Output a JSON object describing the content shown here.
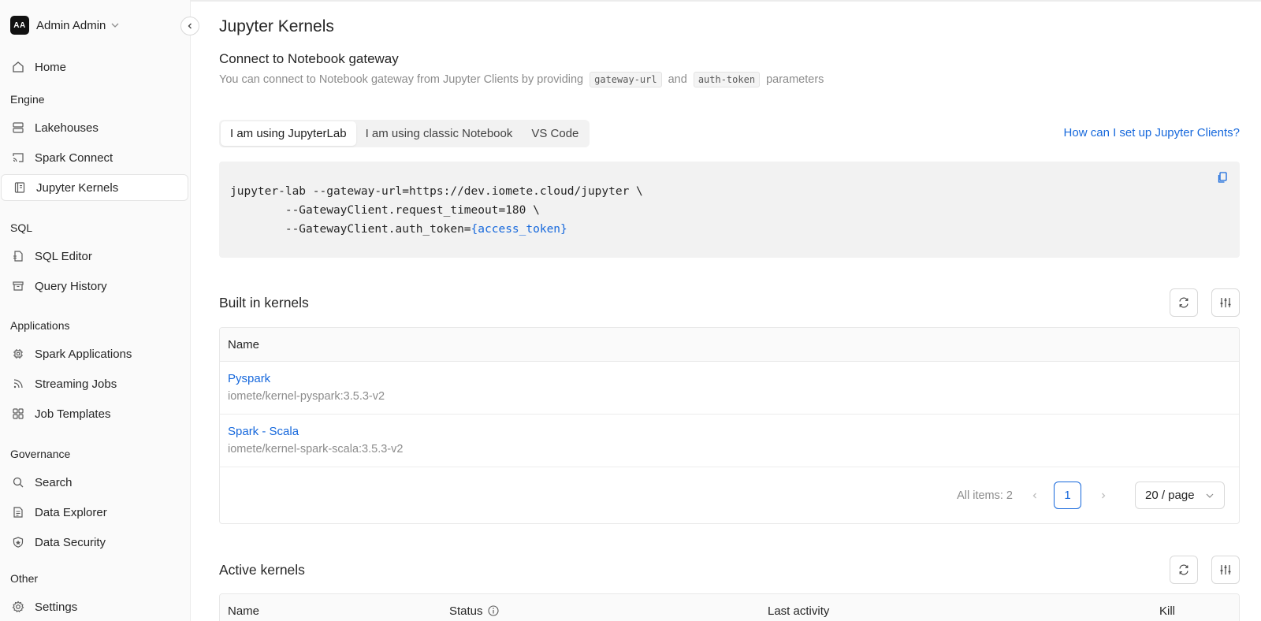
{
  "user": {
    "initials": "AA",
    "name": "Admin Admin"
  },
  "sidebar": {
    "home": "Home",
    "sections": {
      "engine": "Engine",
      "sql": "SQL",
      "applications": "Applications",
      "governance": "Governance",
      "other": "Other"
    },
    "items": {
      "lakehouses": "Lakehouses",
      "spark_connect": "Spark Connect",
      "jupyter_kernels": "Jupyter Kernels",
      "sql_editor": "SQL Editor",
      "query_history": "Query History",
      "spark_applications": "Spark Applications",
      "streaming_jobs": "Streaming Jobs",
      "job_templates": "Job Templates",
      "search": "Search",
      "data_explorer": "Data Explorer",
      "data_security": "Data Security",
      "settings": "Settings"
    },
    "active": "jupyter_kernels"
  },
  "page": {
    "title": "Jupyter Kernels",
    "subtitle": "Connect to Notebook gateway",
    "desc_prefix": "You can connect to Notebook gateway from Jupyter Clients by providing",
    "desc_chip1": "gateway-url",
    "desc_and": "and",
    "desc_chip2": "auth-token",
    "desc_suffix": "parameters"
  },
  "tabs": {
    "items": [
      "I am using JupyterLab",
      "I am using classic Notebook",
      "VS Code"
    ],
    "selected": "I am using JupyterLab"
  },
  "help_link": "How can I set up Jupyter Clients?",
  "code": {
    "line1": "jupyter-lab --gateway-url=https://dev.iomete.cloud/jupyter \\",
    "line2": "        --GatewayClient.request_timeout=180 \\",
    "line3_prefix": "        --GatewayClient.auth_token=",
    "line3_var": "{access_token}"
  },
  "built_in": {
    "title": "Built in kernels",
    "col_name": "Name",
    "rows": [
      {
        "name": "Pyspark",
        "image": "iomete/kernel-pyspark:3.5.3-v2"
      },
      {
        "name": "Spark - Scala",
        "image": "iomete/kernel-spark-scala:3.5.3-v2"
      }
    ],
    "pagination": {
      "total_label": "All items: 2",
      "current_page": "1",
      "page_size": "20 / page"
    }
  },
  "active_kernels": {
    "title": "Active kernels",
    "columns": {
      "name": "Name",
      "status": "Status",
      "last_activity": "Last activity",
      "kill": "Kill"
    }
  },
  "colors": {
    "accent": "#1668dc",
    "sidebar_bg": "#fafafa",
    "muted": "#8c8c8c"
  }
}
